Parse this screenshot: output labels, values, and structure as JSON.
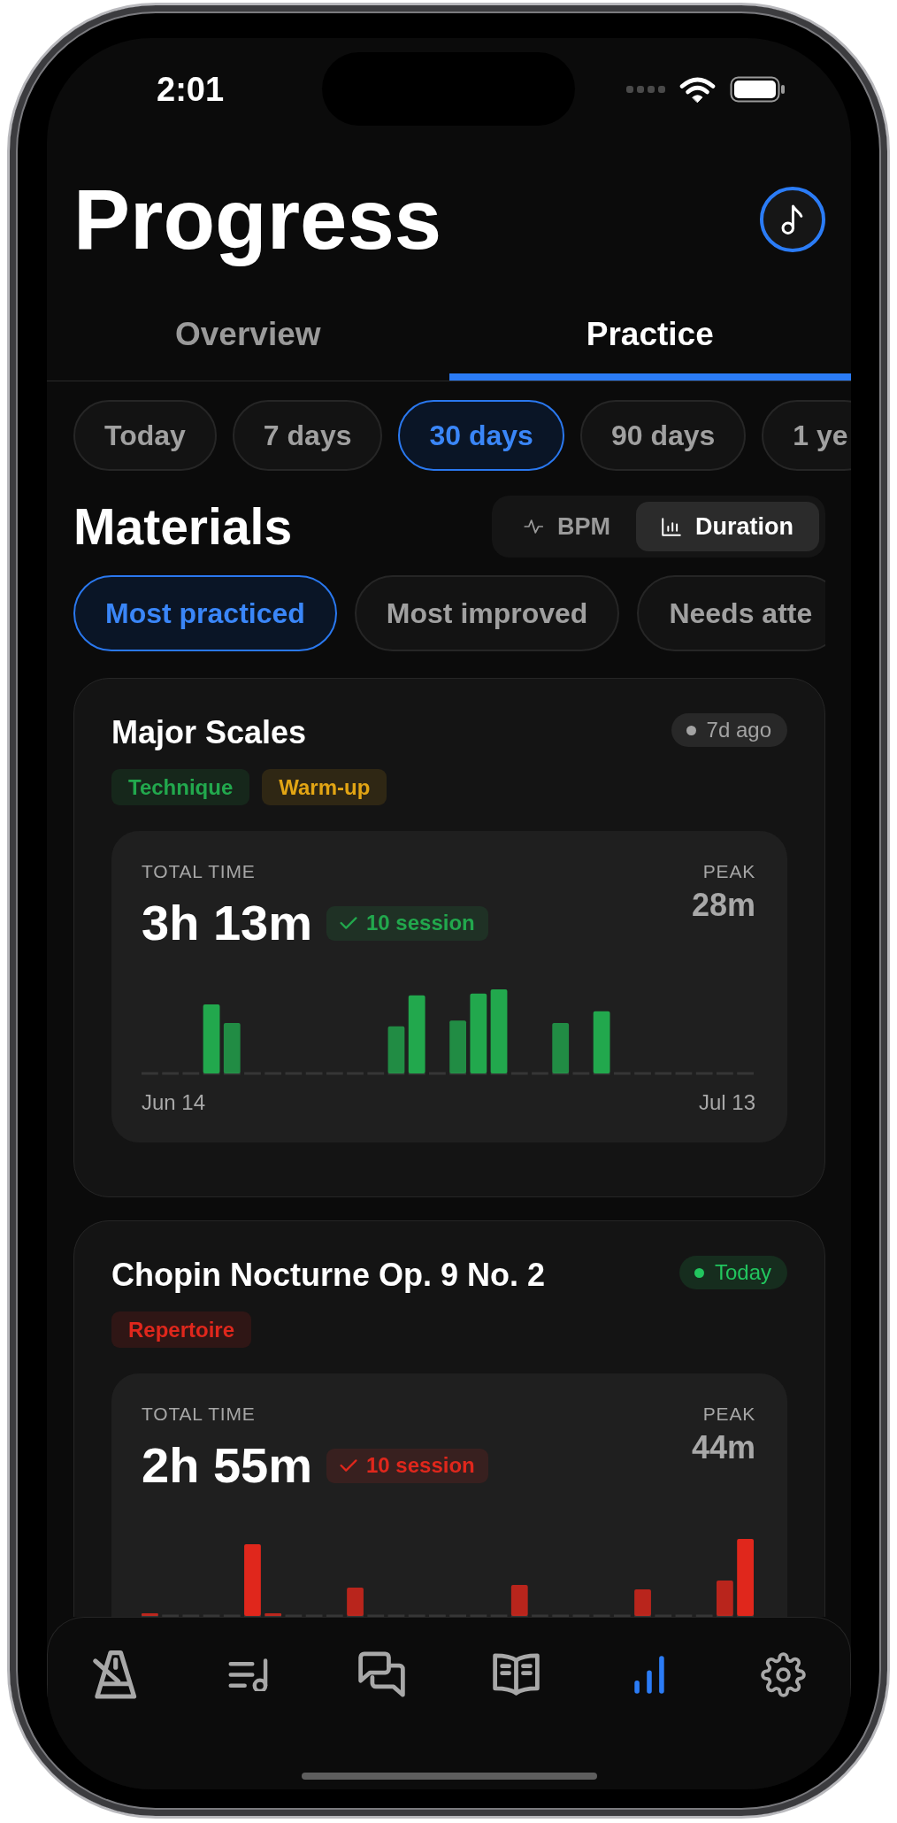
{
  "status_bar": {
    "time": "2:01"
  },
  "header": {
    "title": "Progress"
  },
  "tabs": [
    {
      "label": "Overview",
      "selected": false
    },
    {
      "label": "Practice",
      "selected": true
    }
  ],
  "ranges": [
    {
      "label": "Today",
      "selected": false
    },
    {
      "label": "7 days",
      "selected": false
    },
    {
      "label": "30 days",
      "selected": true
    },
    {
      "label": "90 days",
      "selected": false
    },
    {
      "label": "1 ye",
      "selected": false
    }
  ],
  "materials": {
    "title": "Materials",
    "metric_toggle": [
      {
        "label": "BPM",
        "selected": false
      },
      {
        "label": "Duration",
        "selected": true
      }
    ],
    "filters": [
      {
        "label": "Most practiced",
        "selected": true
      },
      {
        "label": "Most improved",
        "selected": false
      },
      {
        "label": "Needs atte",
        "selected": false
      }
    ],
    "cards": [
      {
        "title": "Major Scales",
        "last_practiced": {
          "label": "7d ago",
          "color": "#a3a3a3"
        },
        "tags": [
          {
            "label": "Technique",
            "color": "#22a84d"
          },
          {
            "label": "Warm-up",
            "color": "#e2a514"
          }
        ],
        "total_label": "TOTAL TIME",
        "total": "3h 13m",
        "sessions": "10 session",
        "peak_label": "PEAK",
        "peak": "28m",
        "start_date": "Jun 14",
        "end_date": "Jul 13"
      },
      {
        "title": "Chopin Nocturne Op. 9 No. 2",
        "last_practiced": {
          "label": "Today",
          "color": "#22c55e"
        },
        "tags": [
          {
            "label": "Repertoire",
            "color": "#e0271c"
          }
        ],
        "total_label": "TOTAL TIME",
        "total": "2h 55m",
        "sessions": "10 session",
        "peak_label": "PEAK",
        "peak": "44m"
      }
    ]
  },
  "nav": {
    "items": [
      {
        "selected": false
      },
      {
        "selected": false
      },
      {
        "selected": false
      },
      {
        "selected": false
      },
      {
        "selected": true
      },
      {
        "selected": false
      }
    ]
  }
}
